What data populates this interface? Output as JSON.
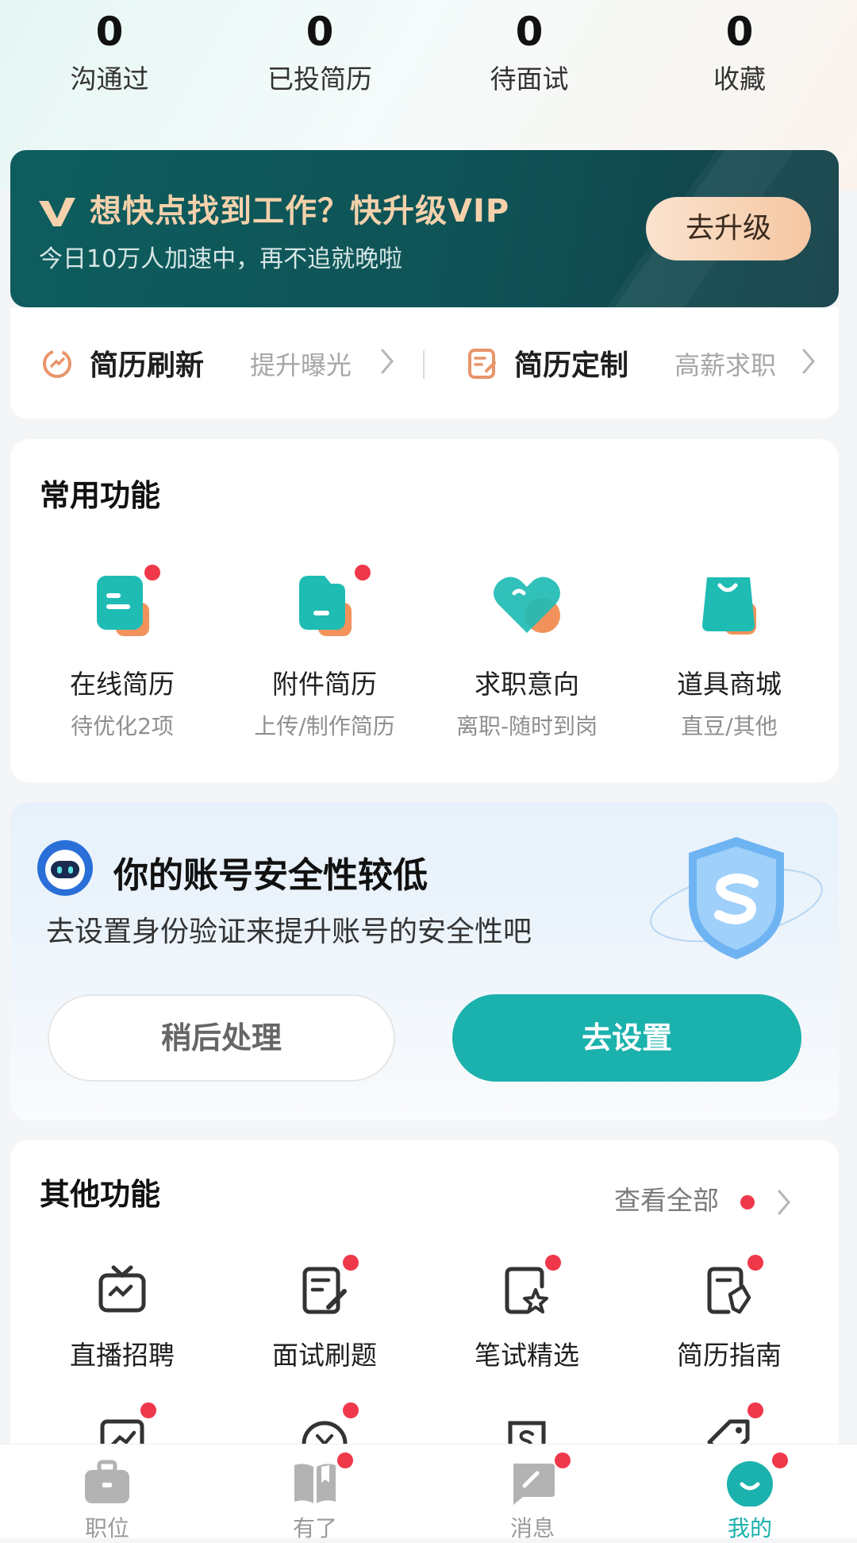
{
  "stats": [
    {
      "value": "0",
      "label": "沟通过"
    },
    {
      "value": "0",
      "label": "已投简历"
    },
    {
      "value": "0",
      "label": "待面试"
    },
    {
      "value": "0",
      "label": "收藏"
    }
  ],
  "vip_banner": {
    "title": "想快点找到工作？快升级VIP",
    "subtitle": "今日10万人加速中，再不追就晚啦",
    "button": "去升级",
    "accent": "#f4d1ab"
  },
  "resume_strip": {
    "refresh": {
      "title": "简历刷新",
      "hint": "提升曝光",
      "icon": "refresh-icon"
    },
    "custom": {
      "title": "简历定制",
      "hint": "高薪求职",
      "icon": "edit-doc-icon"
    }
  },
  "common": {
    "title": "常用功能",
    "items": [
      {
        "name": "在线简历",
        "desc": "待优化2项",
        "icon": "online-resume-icon"
      },
      {
        "name": "附件简历",
        "desc": "上传/制作简历",
        "icon": "attachment-resume-icon"
      },
      {
        "name": "求职意向",
        "desc": "离职-随时到岗",
        "icon": "job-intent-heart-icon"
      },
      {
        "name": "道具商城",
        "desc": "直豆/其他",
        "icon": "shopping-bag-icon"
      }
    ]
  },
  "security": {
    "title": "你的账号安全性较低",
    "subtitle": "去设置身份验证来提升账号的安全性吧",
    "later_button": "稍后处理",
    "go_button": "去设置",
    "accent": "#1bb1ad"
  },
  "other": {
    "title": "其他功能",
    "view_all": "查看全部",
    "items": [
      {
        "name": "直播招聘",
        "icon": "live-tv-icon"
      },
      {
        "name": "面试刷题",
        "icon": "quiz-edit-icon"
      },
      {
        "name": "笔试精选",
        "icon": "star-doc-icon"
      },
      {
        "name": "简历指南",
        "icon": "guide-doc-icon"
      }
    ]
  },
  "nav": [
    {
      "label": "职位",
      "icon": "briefcase-icon"
    },
    {
      "label": "有了",
      "icon": "book-icon"
    },
    {
      "label": "消息",
      "icon": "message-icon"
    },
    {
      "label": "我的",
      "icon": "profile-smile-icon"
    }
  ]
}
